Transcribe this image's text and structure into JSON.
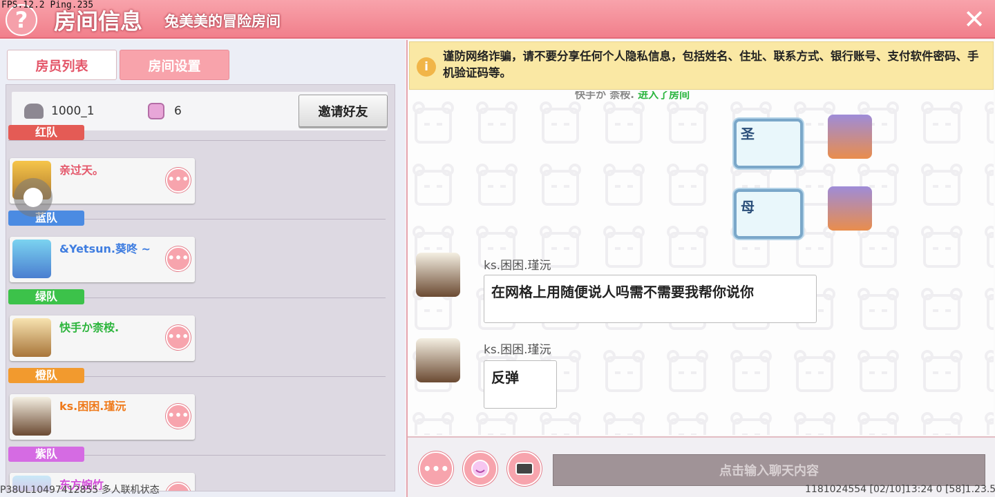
{
  "header": {
    "fps": "FPS.12.2  Ping.235",
    "title": "房间信息",
    "subtitle": "兔美美的冒险房间"
  },
  "tabs": {
    "members": "房员列表",
    "settings": "房间设置"
  },
  "room": {
    "id": "1000_1",
    "player_count": "6",
    "invite_label": "邀请好友"
  },
  "teams": [
    {
      "label": "红队",
      "color": "#e45b55"
    },
    {
      "label": "蓝队",
      "color": "#4b8be2"
    },
    {
      "label": "绿队",
      "color": "#3cc24a"
    },
    {
      "label": "橙队",
      "color": "#f29a2e"
    },
    {
      "label": "紫队",
      "color": "#d56be3"
    }
  ],
  "members": [
    {
      "name": "亲过天。",
      "color": "#e4576a"
    },
    {
      "name": "&Yetsun.葵咚 ~",
      "color": "#3f7de0"
    },
    {
      "name": "快手か柰桉.",
      "color": "#2db53d"
    },
    {
      "name": "ks.困困.瑾沅",
      "color": "#ef7a1b"
    },
    {
      "name": "东方婉竹",
      "color": "#d24cd8"
    }
  ],
  "more_label": "•••",
  "footer": {
    "left_status": "P38UL10497412855 多人联机状态",
    "right_status": "1181024554    [02/10]13:24 0    [58]1.23.5"
  },
  "warning": {
    "icon": "i",
    "text": "谨防网络诈骗，请不要分享任何个人隐私信息，包括姓名、住址、联系方式、银行账号、支付软件密码、手机验证码等。"
  },
  "chat": {
    "system_prefix": "快手か 柰桉.",
    "system_suffix": "进入了房间",
    "emoji_1": "圣",
    "emoji_2": "母",
    "messages": [
      {
        "sender": "ks.困困.瑾沅",
        "text": "在网格上用随便说人吗需不需要我帮你说你"
      },
      {
        "sender": "ks.困困.瑾沅",
        "text": "反弹"
      }
    ],
    "input_placeholder": "点击输入聊天内容",
    "close_glyph": "✕",
    "help_glyph": "?"
  }
}
